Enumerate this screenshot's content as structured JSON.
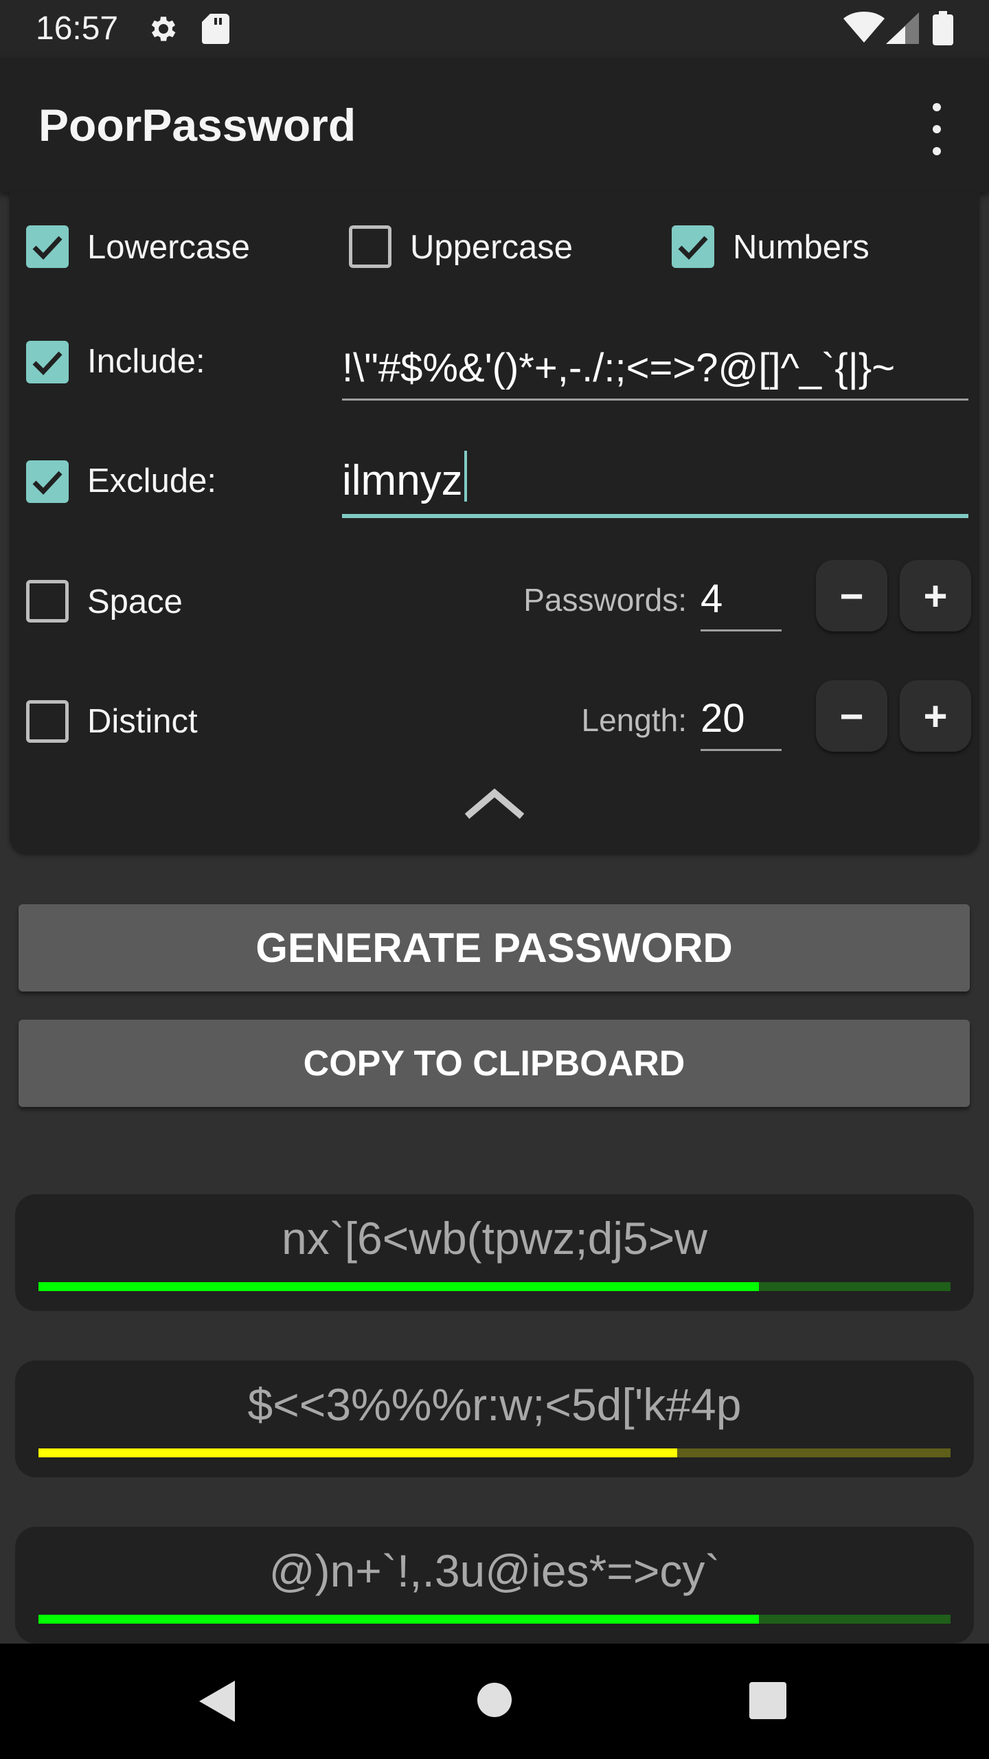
{
  "status_bar": {
    "time": "16:57",
    "icons": [
      "gear-icon",
      "sd-card-icon",
      "wifi-icon",
      "signal-icon",
      "battery-icon"
    ]
  },
  "app_bar": {
    "title": "PoorPassword",
    "menu_icon": "more-vert-icon"
  },
  "options": {
    "lowercase": {
      "label": "Lowercase",
      "checked": true
    },
    "uppercase": {
      "label": "Uppercase",
      "checked": false
    },
    "numbers": {
      "label": "Numbers",
      "checked": true
    },
    "include": {
      "label": "Include:",
      "checked": true,
      "value": "!\\\"#$%&'()*+,-./:;<=>?@[]^_`{|}~"
    },
    "exclude": {
      "label": "Exclude:",
      "checked": true,
      "value": "ilmnyz"
    },
    "space": {
      "label": "Space",
      "checked": false
    },
    "distinct": {
      "label": "Distinct",
      "checked": false
    },
    "passwords": {
      "label": "Passwords:",
      "value": "4",
      "minus": "−",
      "plus": "+"
    },
    "length": {
      "label": "Length:",
      "value": "20",
      "minus": "−",
      "plus": "+"
    },
    "collapse_icon": "chevron-up-icon"
  },
  "actions": {
    "generate": "GENERATE PASSWORD",
    "copy": "COPY TO CLIPBOARD"
  },
  "passwords": [
    {
      "text": "nx`[6<wb(tpwz;dj5>w",
      "strength": 0.79,
      "color": "#00ff00",
      "track": "#1f5f1a"
    },
    {
      "text": "$<<3%%%r:w;<5d['k#4p",
      "strength": 0.7,
      "color": "#ffff00",
      "track": "#5f5f1a"
    },
    {
      "text": "@)n+`!,.3u@ies*=>cy`",
      "strength": 0.79,
      "color": "#00ff00",
      "track": "#1f5f1a"
    }
  ],
  "nav_bar": {
    "back": "back-icon",
    "home": "home-icon",
    "recents": "recents-icon"
  },
  "colors": {
    "accent": "#80cbc4",
    "card": "#212121",
    "background": "#303030",
    "button": "#5b5b5b"
  }
}
